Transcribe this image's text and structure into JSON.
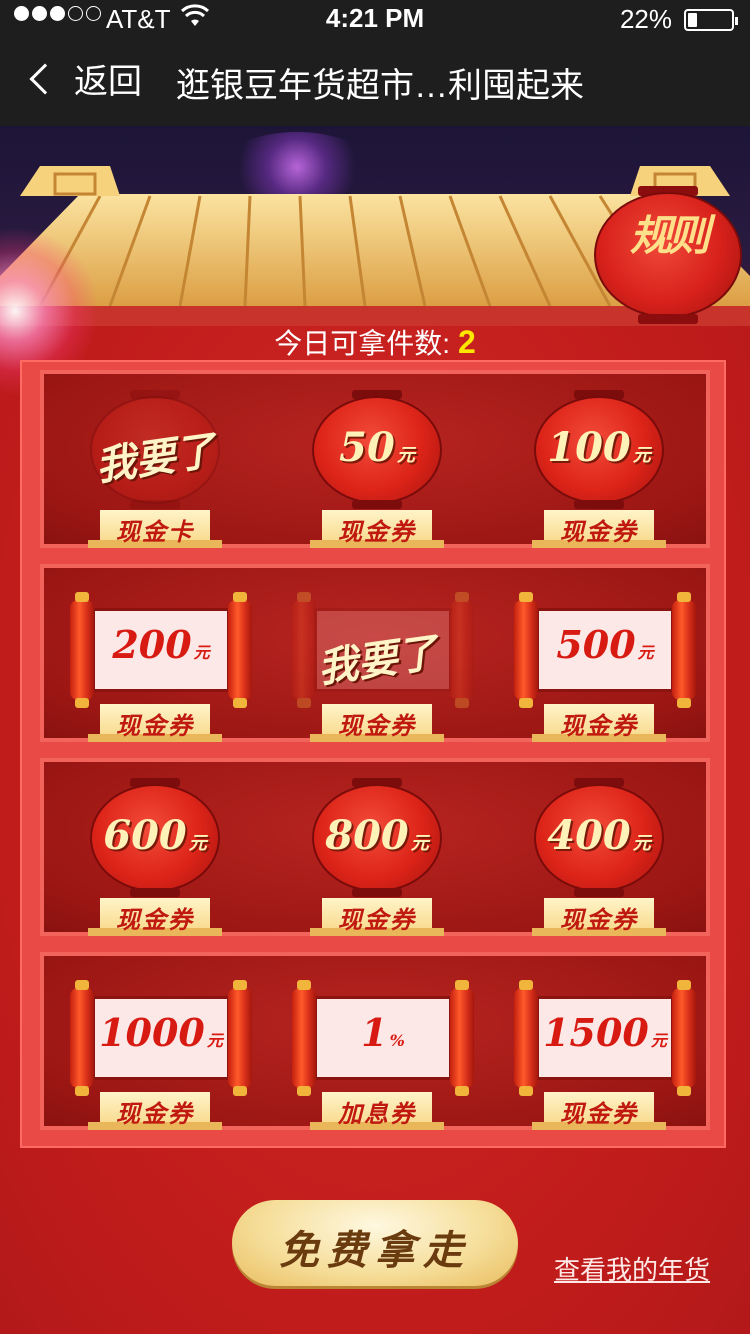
{
  "status_bar": {
    "carrier": "AT&T",
    "time": "4:21 PM",
    "battery_percent": "22%",
    "battery_level": 0.22
  },
  "nav": {
    "back_label": "返回",
    "title": "逛银豆年货超市…利囤起来"
  },
  "rules_label": "规则",
  "counter": {
    "label": "今日可拿件数:",
    "value": "2"
  },
  "taken_text": "我要了",
  "rows": [
    [
      {
        "style": "lantern",
        "amount": "",
        "unit": "",
        "name": "现金卡",
        "taken": true
      },
      {
        "style": "lantern",
        "amount": "50",
        "unit": "元",
        "name": "现金券",
        "taken": false
      },
      {
        "style": "lantern",
        "amount": "100",
        "unit": "元",
        "name": "现金券",
        "taken": false
      }
    ],
    [
      {
        "style": "scroll",
        "amount": "200",
        "unit": "元",
        "name": "现金券",
        "taken": false
      },
      {
        "style": "scroll",
        "amount": "",
        "unit": "",
        "name": "现金券",
        "taken": true
      },
      {
        "style": "scroll",
        "amount": "500",
        "unit": "元",
        "name": "现金券",
        "taken": false
      }
    ],
    [
      {
        "style": "lantern",
        "amount": "600",
        "unit": "元",
        "name": "现金券",
        "taken": false
      },
      {
        "style": "lantern",
        "amount": "800",
        "unit": "元",
        "name": "现金券",
        "taken": false
      },
      {
        "style": "lantern",
        "amount": "400",
        "unit": "元",
        "name": "现金券",
        "taken": false
      }
    ],
    [
      {
        "style": "scroll",
        "amount": "1000",
        "unit": "元",
        "name": "现金券",
        "taken": false
      },
      {
        "style": "scroll",
        "amount": "1",
        "unit": "%",
        "name": "加息券",
        "taken": false
      },
      {
        "style": "scroll",
        "amount": "1500",
        "unit": "元",
        "name": "现金券",
        "taken": false
      }
    ]
  ],
  "take_button": "免费拿走",
  "my_goods_link": "查看我的年货",
  "colors": {
    "page_red": "#c8201e",
    "gold": "#f6df9c",
    "highlight_yellow": "#ffe600"
  }
}
